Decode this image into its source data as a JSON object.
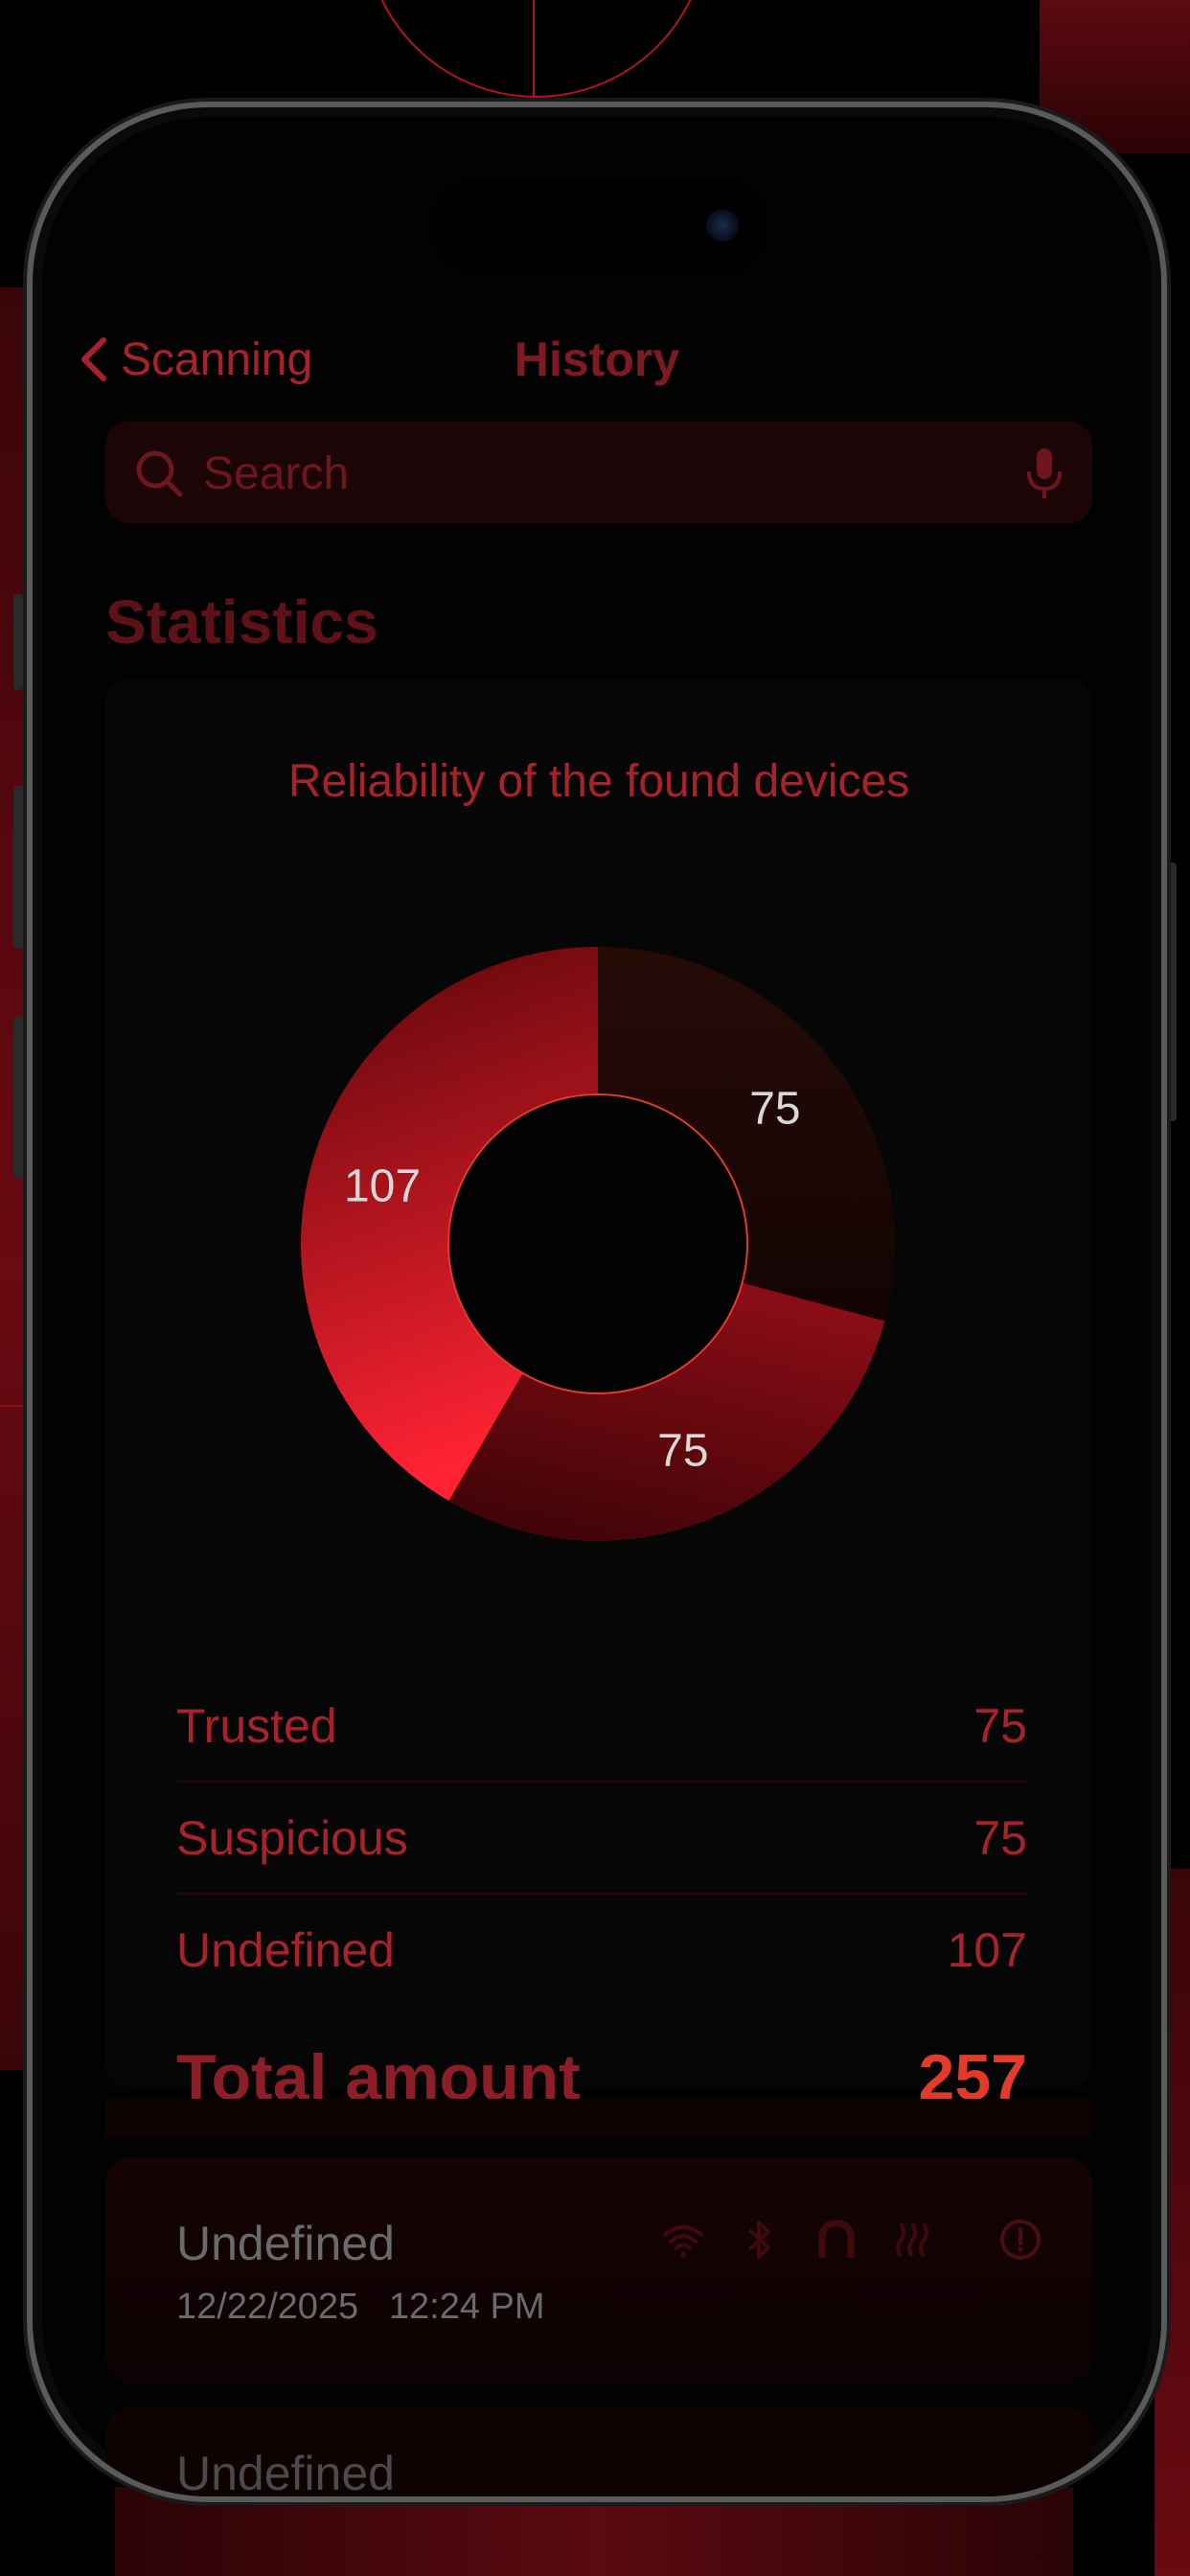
{
  "nav": {
    "back_label": "Scanning",
    "title": "History"
  },
  "search": {
    "placeholder": "Search"
  },
  "statistics": {
    "section_title": "Statistics",
    "card_title": "Reliability of the found devices",
    "rows": [
      {
        "label": "Trusted",
        "value": "75"
      },
      {
        "label": "Suspicious",
        "value": "75"
      },
      {
        "label": "Undefined",
        "value": "107"
      }
    ],
    "total_label": "Total amount",
    "total_value": "257"
  },
  "chart_data": {
    "type": "pie",
    "categories": [
      "Trusted",
      "Suspicious",
      "Undefined"
    ],
    "values": [
      75,
      75,
      107
    ],
    "slice_labels": [
      "75",
      "75",
      "107"
    ],
    "colors": [
      "#1a0605",
      "#6a0810",
      "#c4121e"
    ]
  },
  "history": [
    {
      "title": "Undefined",
      "date": "12/22/2025",
      "time": "12:24 PM",
      "icons": [
        "wifi-icon",
        "bluetooth-icon",
        "magnet-icon",
        "heat-icon"
      ],
      "status_icon": "alert-icon"
    },
    {
      "title": "Undefined"
    }
  ],
  "colors": {
    "accent": "#a8222c",
    "total_accent": "#e33a2a",
    "background": "#000000"
  }
}
